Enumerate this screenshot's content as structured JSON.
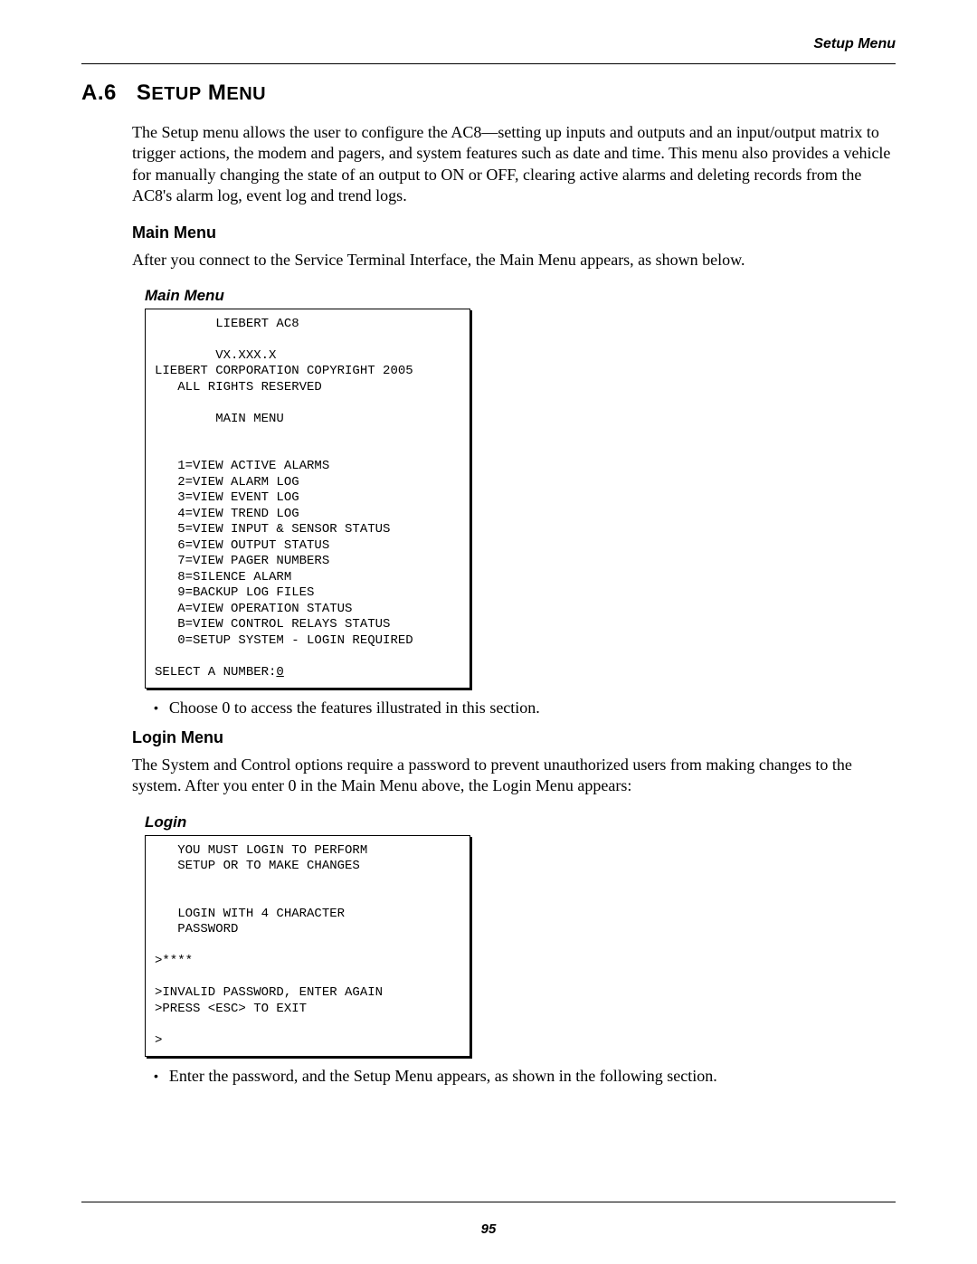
{
  "runningHead": "Setup Menu",
  "section": {
    "number": "A.6",
    "title_html": "S<span style='font-size:20px'>ETUP</span> M<span style='font-size:20px'>ENU</span>"
  },
  "intro": "The Setup menu allows the user to configure the AC8—setting up inputs and outputs and an input/output matrix to trigger actions, the modem and pagers, and system features such as date and time. This menu also provides a vehicle for manually changing the state of an output to ON or OFF, clearing active alarms and deleting records from the AC8's alarm log, event log and trend logs.",
  "mainMenu": {
    "heading": "Main Menu",
    "lead": "After you connect to the Service Terminal Interface, the Main Menu appears, as shown below.",
    "caption": "Main Menu",
    "terminal": "        LIEBERT AC8\n\n        VX.XXX.X\nLIEBERT CORPORATION COPYRIGHT 2005\n   ALL RIGHTS RESERVED\n\n        MAIN MENU\n\n\n   1=VIEW ACTIVE ALARMS\n   2=VIEW ALARM LOG\n   3=VIEW EVENT LOG\n   4=VIEW TREND LOG\n   5=VIEW INPUT & SENSOR STATUS\n   6=VIEW OUTPUT STATUS\n   7=VIEW PAGER NUMBERS\n   8=SILENCE ALARM\n   9=BACKUP LOG FILES\n   A=VIEW OPERATION STATUS\n   B=VIEW CONTROL RELAYS STATUS\n   0=SETUP SYSTEM - LOGIN REQUIRED",
    "prompt_prefix": "SELECT A NUMBER:",
    "prompt_value": "0",
    "bullet": "Choose 0 to access the features illustrated in this section."
  },
  "loginMenu": {
    "heading": "Login Menu",
    "lead": "The System and Control options require a password to prevent unauthorized users from making changes to the system. After you enter 0 in the Main Menu above, the Login Menu appears:",
    "caption": "Login",
    "terminal": "   YOU MUST LOGIN TO PERFORM\n   SETUP OR TO MAKE CHANGES\n\n\n   LOGIN WITH 4 CHARACTER\n   PASSWORD\n\n>****\n\n>INVALID PASSWORD, ENTER AGAIN\n>PRESS <ESC> TO EXIT\n\n>",
    "bullet": "Enter the password, and the Setup Menu appears, as shown in the following section."
  },
  "pageNumber": "95"
}
